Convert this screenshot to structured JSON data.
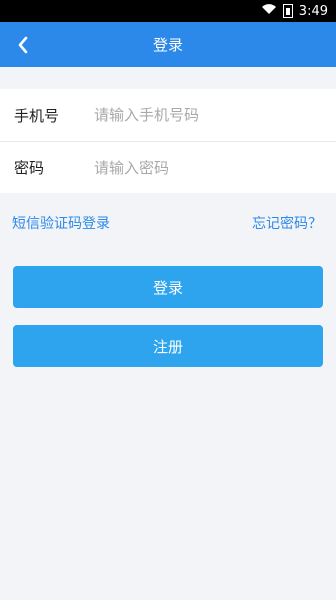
{
  "status_bar": {
    "time": "3:49"
  },
  "header": {
    "title": "登录"
  },
  "form": {
    "phone": {
      "label": "手机号",
      "placeholder": "请输入手机号码"
    },
    "password": {
      "label": "密码",
      "placeholder": "请输入密码"
    }
  },
  "links": {
    "sms_login": "短信验证码登录",
    "forgot_password": "忘记密码？"
  },
  "buttons": {
    "login": "登录",
    "register": "注册"
  },
  "colors": {
    "primary": "#2c89ea",
    "button": "#2ea4ee",
    "background": "#f2f4f8"
  },
  "icons": {
    "back": "chevron-left-icon",
    "wifi": "wifi-icon",
    "battery": "battery-icon"
  }
}
